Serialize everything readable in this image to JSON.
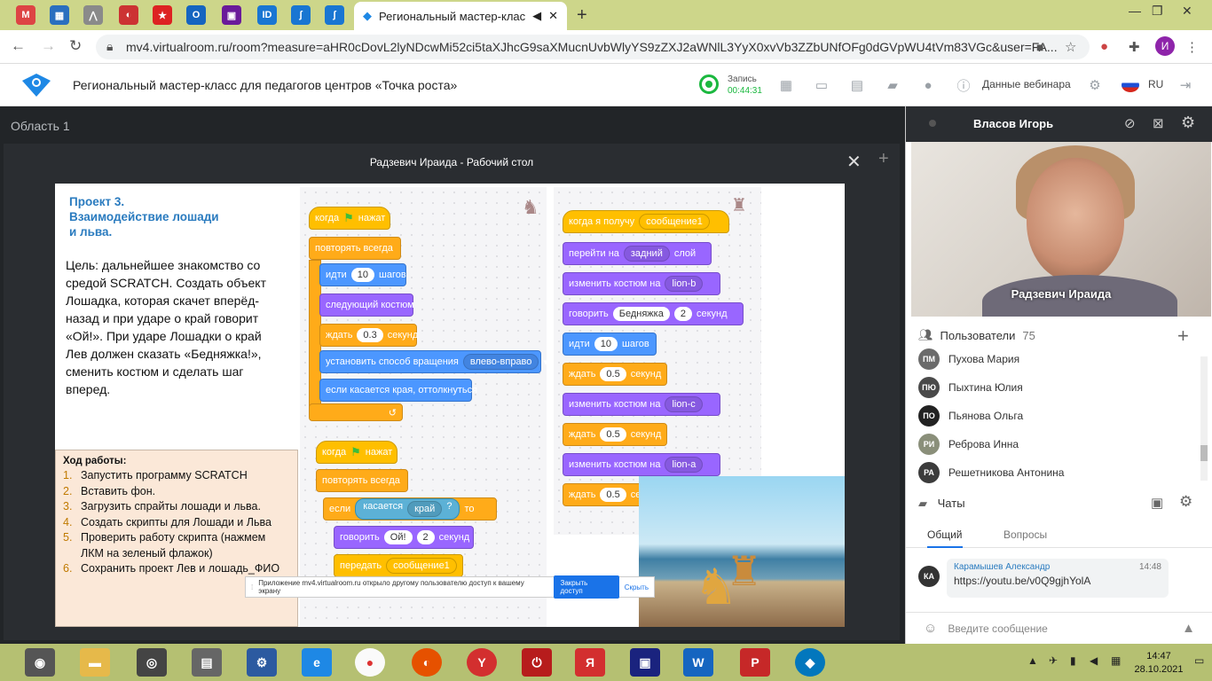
{
  "browser": {
    "active_tab_title": "Региональный мастер-класс",
    "url": "mv4.virtualroom.ru/room?measure=aHR0cDovL2lyNDcwMi52ci5taXJhcG9saXMucnUvbWlyYS9zZXJ2aWNlL3YyX0xvVb3ZZbUNfOFg0dGVpWU4tVm83VGc&user=FA..."
  },
  "app": {
    "title": "Региональный мастер-класс для педагогов центров «Точка роста»",
    "recording_label": "Запись",
    "recording_time": "00:44:31",
    "webinar_data": "Данные вебинара",
    "lang": "RU"
  },
  "area": {
    "title": "Область 1",
    "desktop_title": "Радзевич Ираида - Рабочий стол"
  },
  "slide": {
    "project_title": "Проект 3.\nВзаимодействие лошади\nи льва.",
    "goal": "Цель: дальнейшее знакомство со средой SCRATCH. Создать объект Лошадка, которая скачет вперёд-назад и при ударе о край говорит «Ой!». При ударе Лошадки о край Лев должен сказать «Бедняжка!», сменить костюм и сделать шаг вперед.",
    "steps_header": "Ход работы:",
    "steps": [
      {
        "n": "1.",
        "text": "Запустить программу SCRATCH"
      },
      {
        "n": "2.",
        "text": "Вставить фон."
      },
      {
        "n": "3.",
        "text": "Загрузить спрайты лошади и льва."
      },
      {
        "n": "4.",
        "text": "Создать скрипты для Лошади и Льва"
      },
      {
        "n": "5.",
        "text": "Проверить работу скрипта (нажмем ЛКМ на зеленый флажок)"
      },
      {
        "n": "6.",
        "text": "Сохранить проект Лев и лошадь_ФИО"
      }
    ],
    "horse_blocks": {
      "when_flag": "когда",
      "clicked": "нажат",
      "forever": "повторять всегда",
      "move": "идти",
      "move_val": "10",
      "steps": "шагов",
      "next_costume": "следующий костюм",
      "wait": "ждать",
      "wait_val": "0.3",
      "sec": "секунд",
      "rotation": "установить способ вращения",
      "rotation_val": "влево-вправо",
      "bounce": "если касается края, оттолкнуться"
    },
    "horse_blocks2": {
      "when_flag": "когда",
      "clicked": "нажат",
      "forever": "повторять всегда",
      "if": "если",
      "touching": "касается",
      "edge": "край",
      "q": "?",
      "then": "то",
      "say": "говорить",
      "say_val": "Ой!",
      "say_secs": "2",
      "sec": "секунд",
      "broadcast": "передать",
      "broadcast_val": "сообщение1"
    },
    "lion_blocks": {
      "when_receive": "когда я получу",
      "message": "сообщение1",
      "go_to": "перейти на",
      "layer": "задний",
      "layer_word": "слой",
      "switch_costume": "изменить костюм на",
      "costume_b": "lion-b",
      "say": "говорить",
      "say_val": "Бедняжка",
      "say_secs": "2",
      "sec": "секунд",
      "move": "идти",
      "move_val": "10",
      "steps": "шагов",
      "wait": "ждать",
      "wait_val": "0.5",
      "costume_c": "lion-c",
      "costume_a": "lion-a"
    },
    "notice": {
      "text": "Приложение mv4.virtualroom.ru открыло другому пользователю доступ к вашему экрану",
      "close_access": "Закрыть доступ",
      "hide": "Скрыть"
    }
  },
  "speaker": {
    "header_name": "Власов Игорь",
    "video_label": "Радзевич Ираида"
  },
  "users": {
    "label": "Пользователи",
    "count": "75",
    "list": [
      {
        "initials": "ПМ",
        "name": "Пухова Мария",
        "color": "#6b6b6b"
      },
      {
        "initials": "ПЮ",
        "name": "Пыхтина Юлия",
        "color": "#4a4a4a"
      },
      {
        "initials": "ПО",
        "name": "Пьянова Ольга",
        "color": "#222222"
      },
      {
        "initials": "РИ",
        "name": "Реброва Инна",
        "color": "#8a8f7a"
      },
      {
        "initials": "РА",
        "name": "Решетникова Антонина",
        "color": "#3c3c3c"
      }
    ]
  },
  "chat": {
    "label": "Чаты",
    "tab_general": "Общий",
    "tab_questions": "Вопросы",
    "message": {
      "initials": "КА",
      "author": "Карамышев Александр",
      "time": "14:48",
      "text": "https://youtu.be/v0Q9gjhYolA"
    },
    "placeholder": "Введите сообщение"
  },
  "taskbar": {
    "time": "14:47",
    "date": "28.10.2021"
  }
}
